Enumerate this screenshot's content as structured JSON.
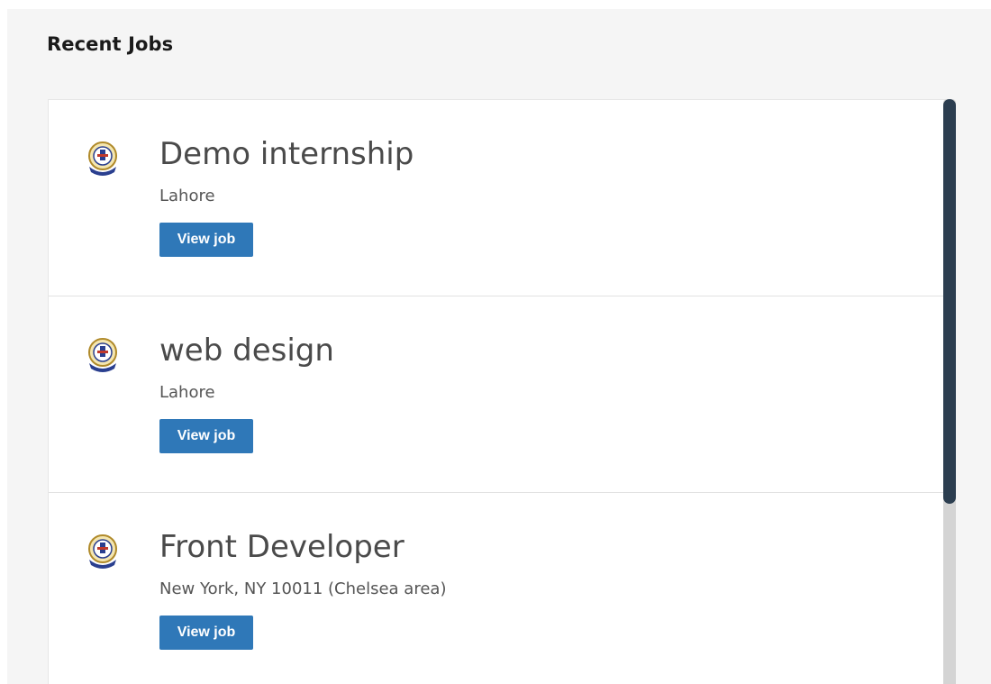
{
  "section": {
    "title": "Recent Jobs"
  },
  "jobs": [
    {
      "title": "Demo internship",
      "location": "Lahore",
      "button_label": "View job",
      "logo_icon": "university-crest-icon"
    },
    {
      "title": "web design",
      "location": "Lahore",
      "button_label": "View job",
      "logo_icon": "university-crest-icon"
    },
    {
      "title": "Front Developer",
      "location": "New York, NY 10011 (Chelsea area)",
      "button_label": "View job",
      "logo_icon": "university-crest-icon"
    }
  ],
  "colors": {
    "button": "#2f78b8",
    "scroll_thumb": "#2c3e50",
    "panel_bg": "#f5f5f5"
  }
}
